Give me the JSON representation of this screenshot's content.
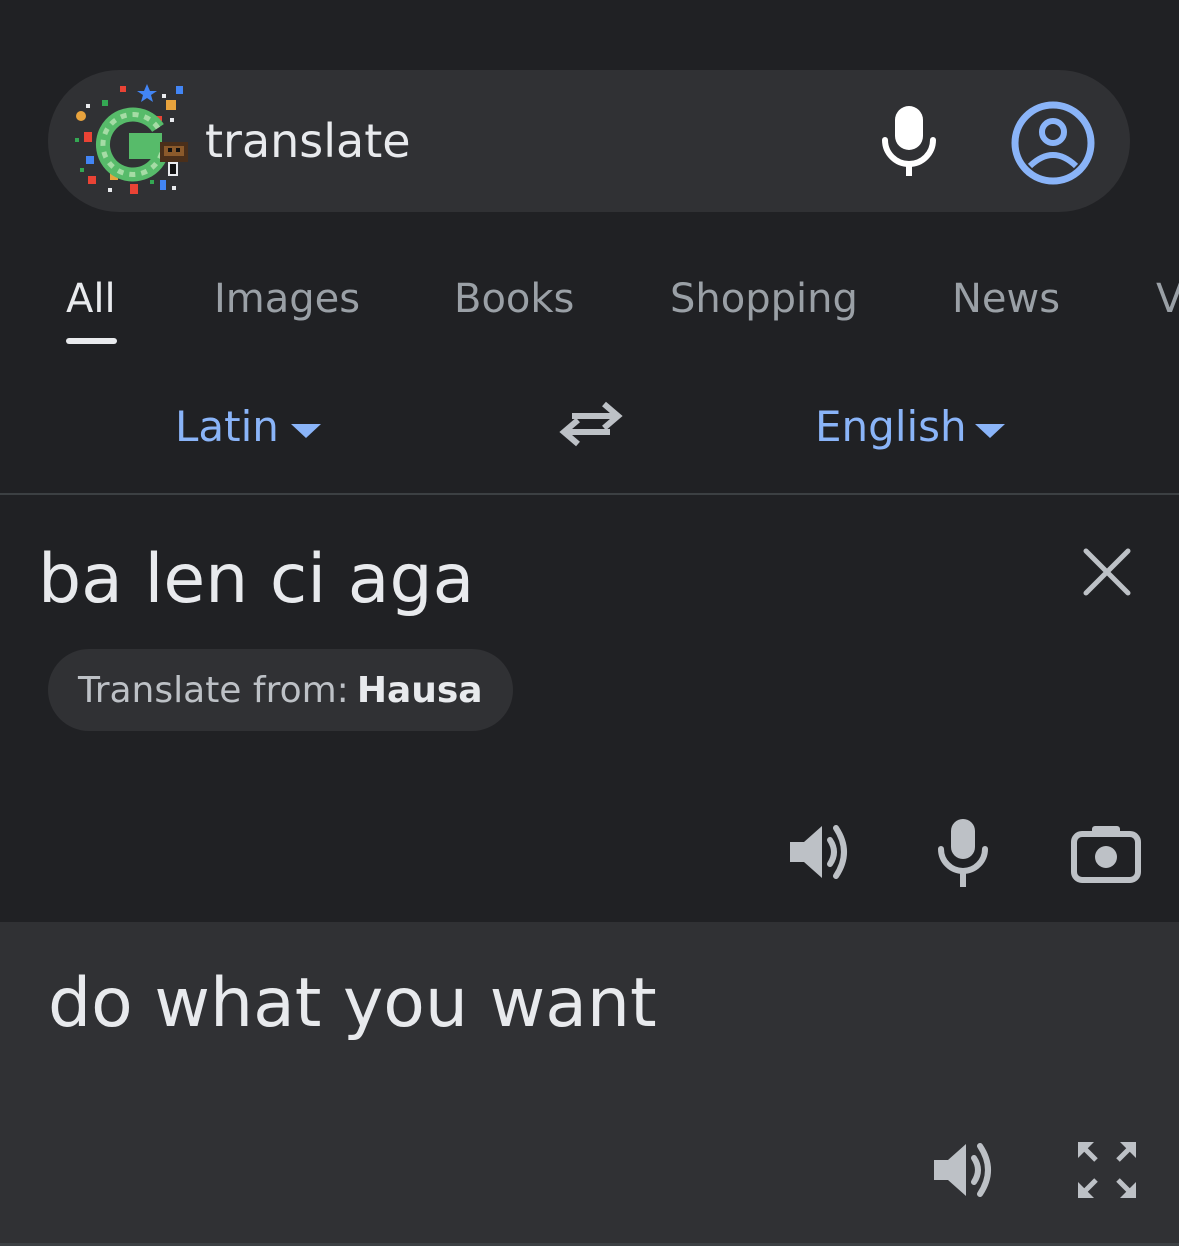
{
  "search": {
    "query": "translate"
  },
  "tabs": [
    {
      "label": "All",
      "active": true
    },
    {
      "label": "Images"
    },
    {
      "label": "Books"
    },
    {
      "label": "Shopping"
    },
    {
      "label": "News"
    },
    {
      "label": "V"
    }
  ],
  "translator": {
    "source_language": "Latin",
    "target_language": "English",
    "source_text": "ba len ci aga",
    "detect_prefix": "Translate from:",
    "detected_language": "Hausa",
    "translated_text": "do what you want"
  },
  "icons": {
    "logo": "google-doodle-logo",
    "voice": "mic-icon",
    "account": "account-circle-icon",
    "swap": "swap-languages-icon",
    "clear": "close-icon",
    "speaker": "speaker-icon",
    "camera": "camera-icon",
    "expand": "fullscreen-icon"
  },
  "colors": {
    "background": "#202124",
    "surface": "#303134",
    "accent": "#8ab4f8",
    "text": "#e8eaed",
    "muted": "#9aa0a6"
  }
}
